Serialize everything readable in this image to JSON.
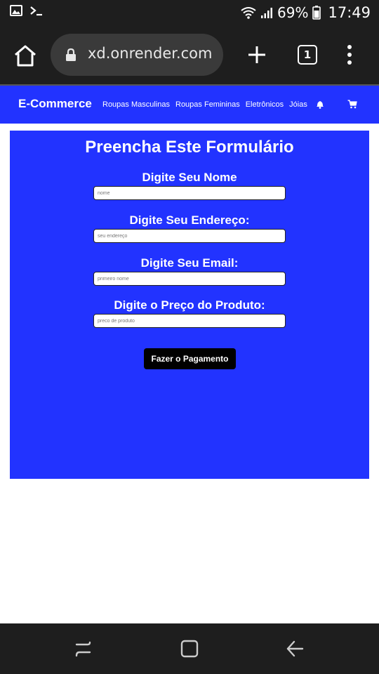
{
  "status_bar": {
    "battery": "69%",
    "time": "17:49"
  },
  "browser": {
    "url": "xd.onrender.com",
    "tab_count": "1"
  },
  "navbar": {
    "brand": "E-Commerce",
    "links": [
      "Roupas Masculinas",
      "Roupas Femininas",
      "Eletrônicos",
      "Jóias"
    ],
    "icons": [
      "bell-icon",
      "cart-icon"
    ]
  },
  "form": {
    "title": "Preencha Este Formulário",
    "fields": [
      {
        "label": "Digite Seu Nome",
        "placeholder": "nome",
        "value": ""
      },
      {
        "label": "Digite Seu Endereço:",
        "placeholder": "seu endereço",
        "value": ""
      },
      {
        "label": "Digite Seu Email:",
        "placeholder": "primeiro nome",
        "value": ""
      },
      {
        "label": "Digite o Preço do Produto:",
        "placeholder": "preco de produto",
        "value": ""
      }
    ],
    "submit_label": "Fazer o Pagamento"
  },
  "colors": {
    "accent": "#2233ff",
    "chrome": "#1e1e1e",
    "button": "#000000"
  }
}
